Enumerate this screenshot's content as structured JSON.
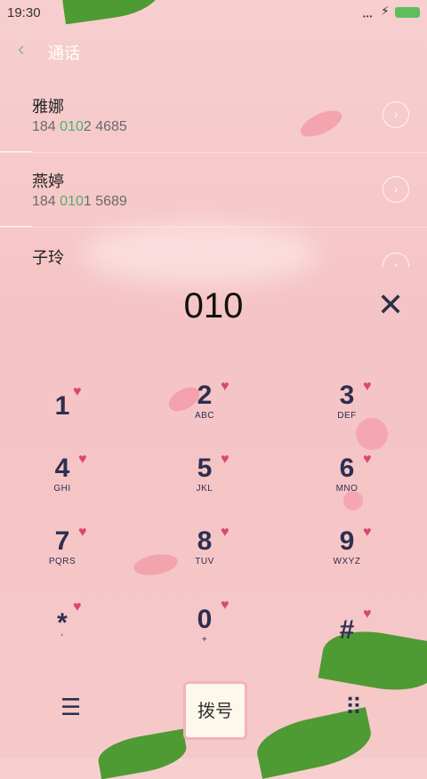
{
  "status_bar": {
    "time": "19:30",
    "signal": "•••",
    "charge": "⚡"
  },
  "header": {
    "back_glyph": "‹",
    "title": "通话"
  },
  "contacts": [
    {
      "name": "雅娜",
      "num_pre": "184 ",
      "num_match": "010",
      "num_post": "2 4685",
      "chevron": "›"
    },
    {
      "name": "燕婷",
      "num_pre": "184 ",
      "num_match": "010",
      "num_post": "1 5689",
      "chevron": "›"
    },
    {
      "name": "子玲",
      "chevron": "›"
    }
  ],
  "dial_input": "010",
  "clear_glyph": "✕",
  "keypad": [
    {
      "digit": "1",
      "letters": ""
    },
    {
      "digit": "2",
      "letters": "ABC"
    },
    {
      "digit": "3",
      "letters": "DEF"
    },
    {
      "digit": "4",
      "letters": "GHI"
    },
    {
      "digit": "5",
      "letters": "JKL"
    },
    {
      "digit": "6",
      "letters": "MNO"
    },
    {
      "digit": "7",
      "letters": "PQRS"
    },
    {
      "digit": "8",
      "letters": "TUV"
    },
    {
      "digit": "9",
      "letters": "WXYZ"
    },
    {
      "digit": "*",
      "letters": ","
    },
    {
      "digit": "0",
      "letters": "+"
    },
    {
      "digit": "#",
      "letters": ""
    }
  ],
  "bottom": {
    "menu_glyph": "☰",
    "dial_label": "拨号",
    "keypad_glyph": "⠿"
  },
  "colors": {
    "accent_green": "#4db06a",
    "key_text": "#2c2f50",
    "heart": "#d94870"
  }
}
